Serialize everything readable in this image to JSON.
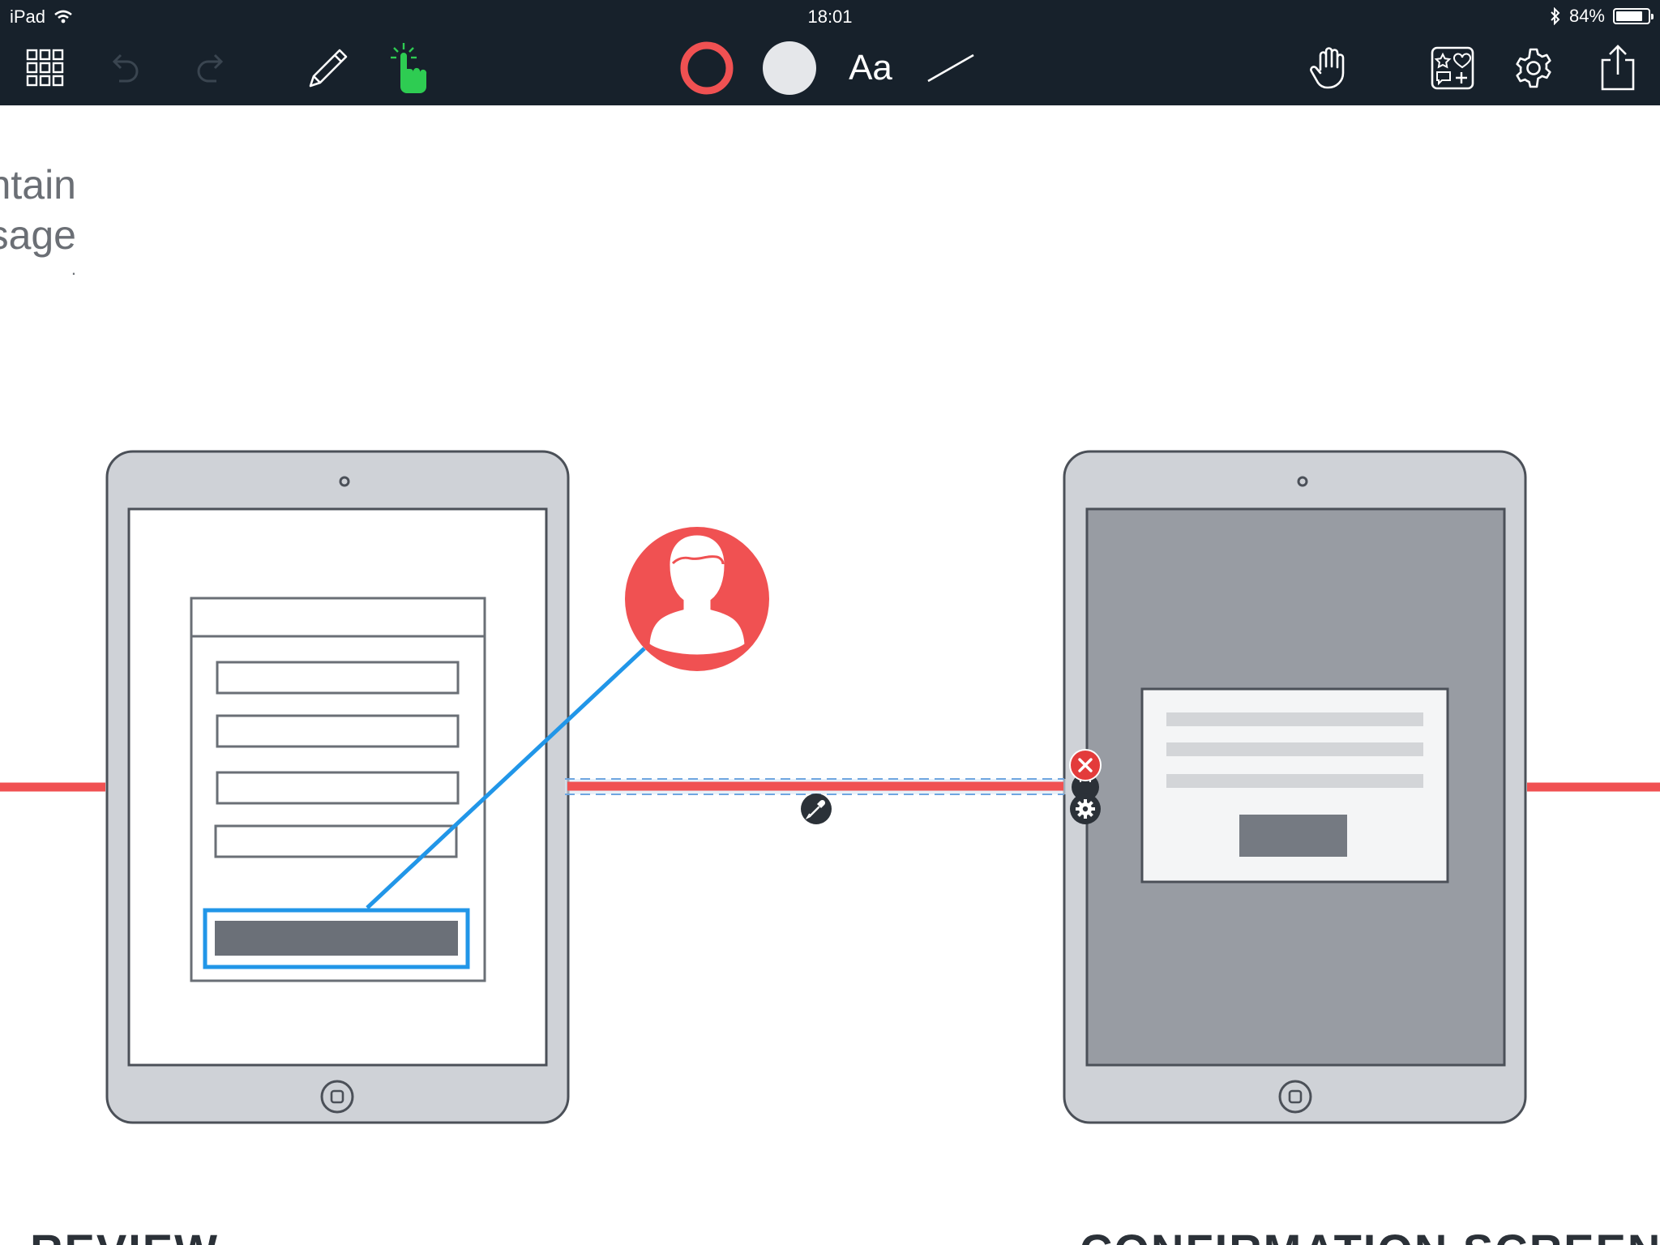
{
  "status_bar": {
    "device": "iPad",
    "time": "18:01",
    "battery": "84%",
    "battery_level": 0.84
  },
  "toolbar": {
    "text_tool_label": "Aa",
    "stroke_color": "#f05152",
    "fill_color": "#e5e7ea",
    "active_tool_color": "#2ecc52"
  },
  "canvas": {
    "intro_text_lines": [
      "ntain",
      "sage",
      "."
    ],
    "left_screen_label": "AIL REVIEW",
    "right_screen_label": "CONFIRMATION SCREEN",
    "accent_line_color": "#f05152",
    "link_color": "#2196e8",
    "user_badge_color": "#f05152"
  }
}
